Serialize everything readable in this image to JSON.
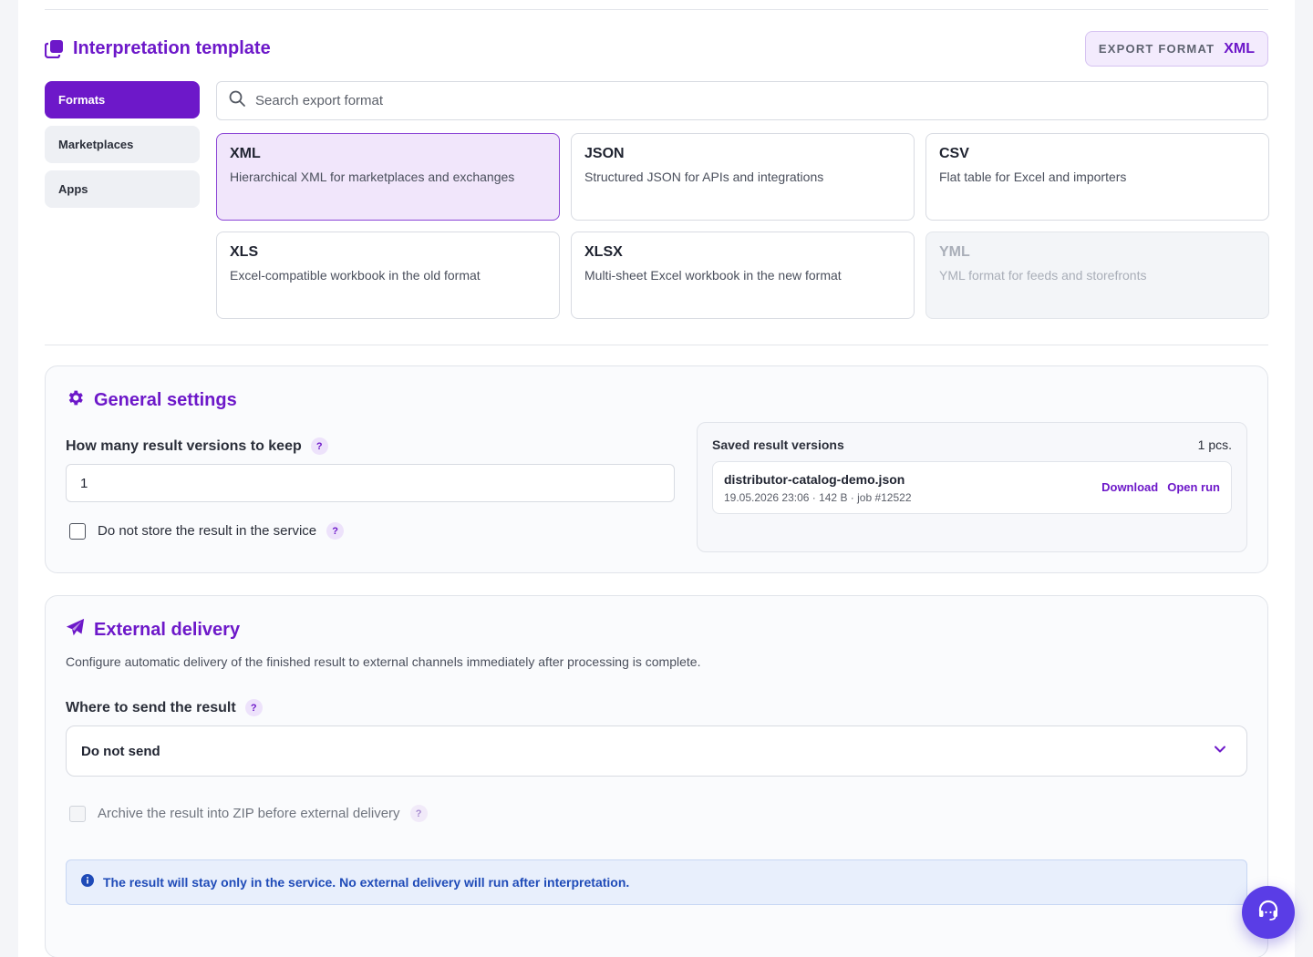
{
  "template": {
    "title": "Interpretation template",
    "export_format_label": "EXPORT FORMAT",
    "export_format_value": "XML"
  },
  "tabs": [
    {
      "label": "Formats",
      "active": true
    },
    {
      "label": "Marketplaces",
      "active": false
    },
    {
      "label": "Apps",
      "active": false
    }
  ],
  "search": {
    "placeholder": "Search export format"
  },
  "formats": [
    {
      "name": "XML",
      "desc": "Hierarchical XML for marketplaces and exchanges",
      "state": "selected"
    },
    {
      "name": "JSON",
      "desc": "Structured JSON for APIs and integrations",
      "state": "normal"
    },
    {
      "name": "CSV",
      "desc": "Flat table for Excel and importers",
      "state": "normal"
    },
    {
      "name": "XLS",
      "desc": "Excel-compatible workbook in the old format",
      "state": "normal"
    },
    {
      "name": "XLSX",
      "desc": "Multi-sheet Excel workbook in the new format",
      "state": "normal"
    },
    {
      "name": "YML",
      "desc": "YML format for feeds and storefronts",
      "state": "disabled"
    }
  ],
  "general": {
    "title": "General settings",
    "versions_label": "How many result versions to keep",
    "versions_value": "1",
    "no_store_label": "Do not store the result in the service",
    "help": "?",
    "saved": {
      "title": "Saved result versions",
      "count": "1 pcs.",
      "items": [
        {
          "file": "distributor-catalog-demo.json",
          "meta": "19.05.2026 23:06 · 142 B · job #12522",
          "download": "Download",
          "open": "Open run"
        }
      ]
    }
  },
  "delivery": {
    "title": "External delivery",
    "description": "Configure automatic delivery of the finished result to external channels immediately after processing is complete.",
    "where_label": "Where to send the result",
    "where_value": "Do not send",
    "zip_label": "Archive the result into ZIP before external delivery",
    "info": "The result will stay only in the service. No external delivery will run after interpretation."
  },
  "colors": {
    "accent": "#6d18c9",
    "info_text": "#1f4bb8",
    "support_button": "#5a3de6"
  },
  "icons": {
    "template": "copy-icon",
    "search": "search-icon",
    "settings": "gear-icon",
    "delivery": "paper-plane-icon",
    "select": "chevron-down-icon",
    "info": "info-icon",
    "support": "headset-icon"
  }
}
